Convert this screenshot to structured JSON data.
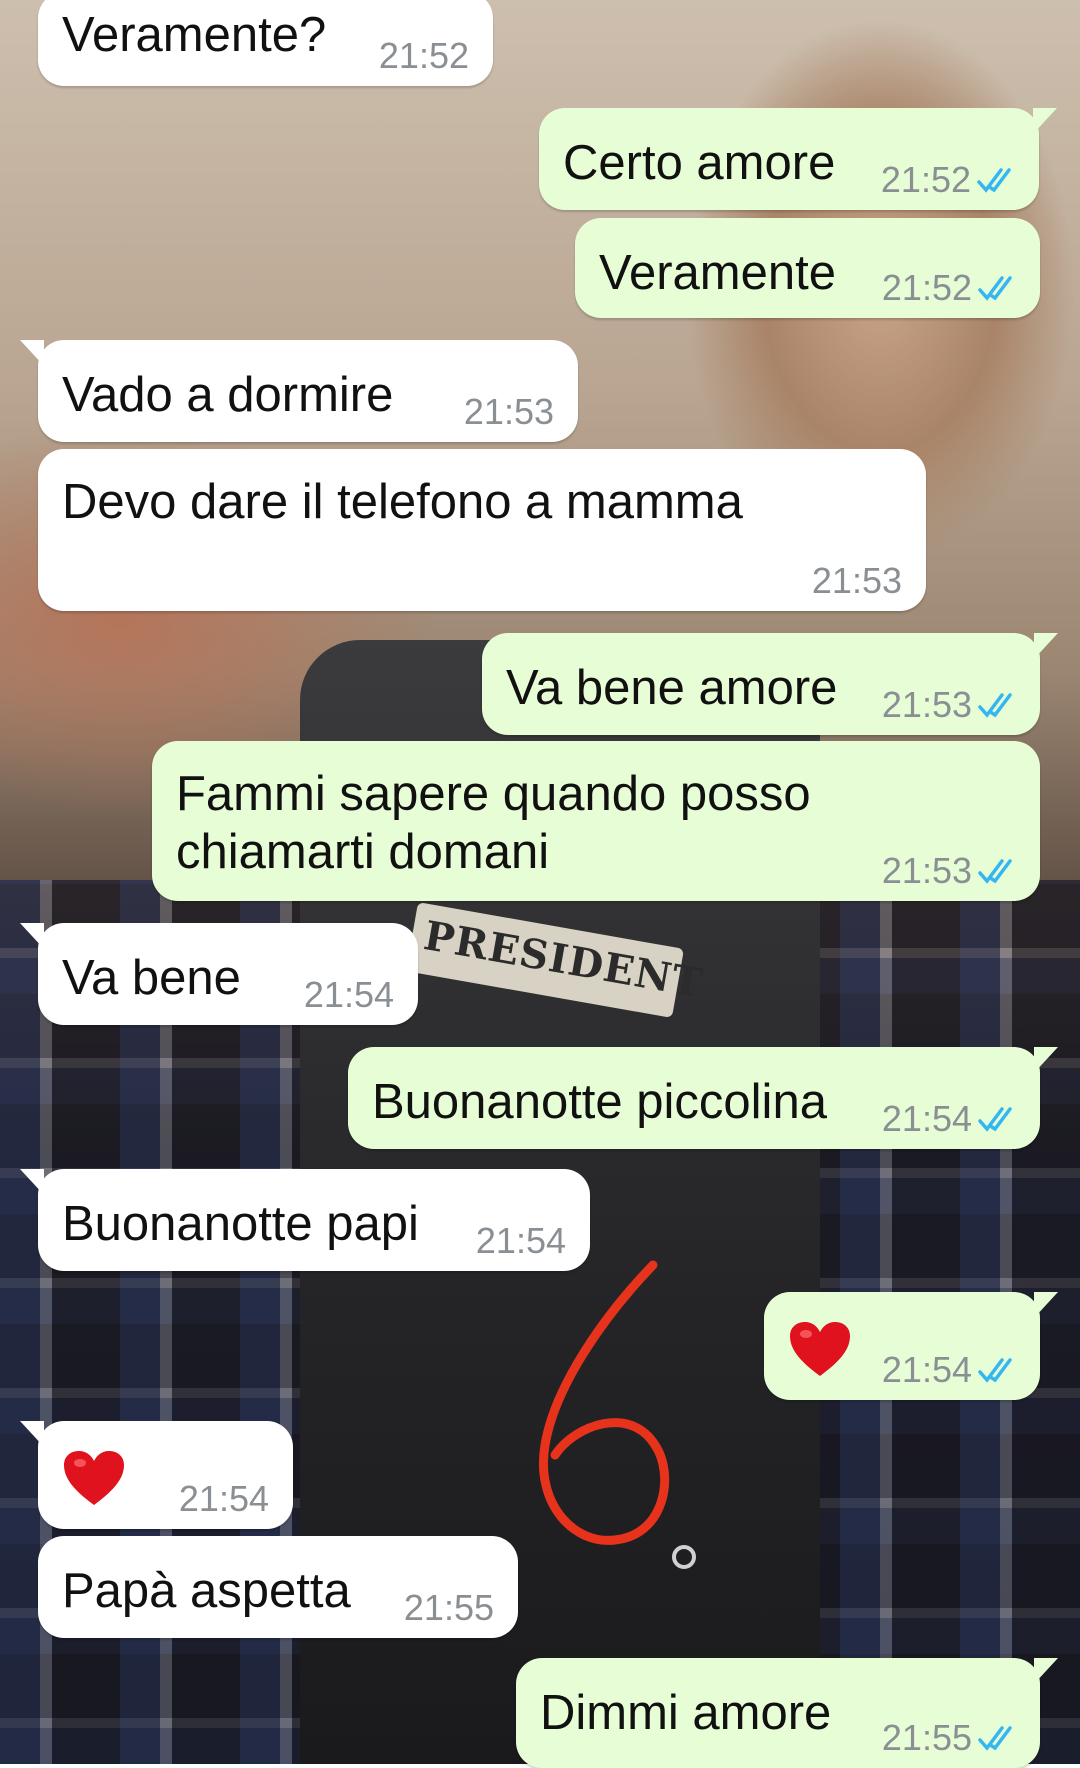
{
  "colors": {
    "incoming_bubble": "#ffffff",
    "outgoing_bubble": "#e7fdd6",
    "timestamp": "#8a8f94",
    "read_ticks": "#34b7f1",
    "heart": "#e0121d",
    "annotation": "#e8331c"
  },
  "background": {
    "patch_text": "PRESIDENT"
  },
  "messages": [
    {
      "direction": "in",
      "text": "Veramente?",
      "time": "21:52"
    },
    {
      "direction": "out",
      "text": "Certo amore",
      "time": "21:52",
      "status": "read-ticks-icon"
    },
    {
      "direction": "out",
      "text": "Veramente",
      "time": "21:52",
      "status": "read-ticks-icon"
    },
    {
      "direction": "in",
      "text": "Vado a dormire",
      "time": "21:53"
    },
    {
      "direction": "in",
      "text": "Devo dare il telefono a mamma",
      "time": "21:53"
    },
    {
      "direction": "out",
      "text": "Va bene amore",
      "time": "21:53",
      "status": "read-ticks-icon"
    },
    {
      "direction": "out",
      "text": "Fammi sapere quando posso\nchiamarti domani",
      "time": "21:53",
      "status": "read-ticks-icon"
    },
    {
      "direction": "in",
      "text": "Va bene",
      "time": "21:54"
    },
    {
      "direction": "out",
      "text": "Buonanotte piccolina",
      "time": "21:54",
      "status": "read-ticks-icon"
    },
    {
      "direction": "in",
      "text": "Buonanotte papi",
      "time": "21:54"
    },
    {
      "direction": "out",
      "emoji": "heart-icon",
      "time": "21:54",
      "status": "read-ticks-icon"
    },
    {
      "direction": "in",
      "emoji": "heart-icon",
      "time": "21:54"
    },
    {
      "direction": "in",
      "text": "Papà aspetta",
      "time": "21:55"
    },
    {
      "direction": "out",
      "text": "Dimmi amore",
      "time": "21:55",
      "status": "read-ticks-icon"
    }
  ]
}
